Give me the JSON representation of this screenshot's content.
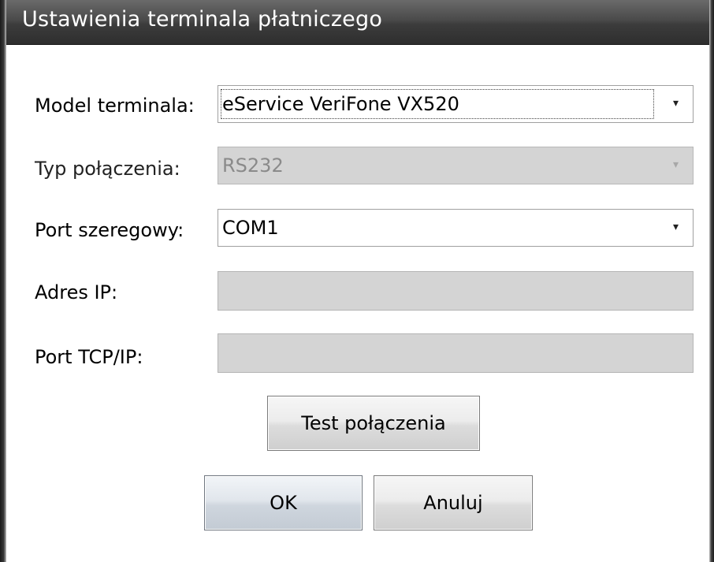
{
  "window": {
    "title": "Ustawienia terminala płatniczego"
  },
  "form": {
    "model": {
      "label": "Model terminala:",
      "value": "eService VeriFone VX520"
    },
    "connection_type": {
      "label": "Typ połączenia:",
      "value": "RS232",
      "disabled": true
    },
    "serial_port": {
      "label": "Port szeregowy:",
      "value": "COM1"
    },
    "ip_address": {
      "label": "Adres IP:",
      "value": "",
      "disabled": true
    },
    "tcp_port": {
      "label": "Port TCP/IP:",
      "value": "",
      "disabled": true
    }
  },
  "buttons": {
    "test": "Test połączenia",
    "ok": "OK",
    "cancel": "Anuluj"
  },
  "icons": {
    "dropdown": "chevron-down-icon"
  }
}
